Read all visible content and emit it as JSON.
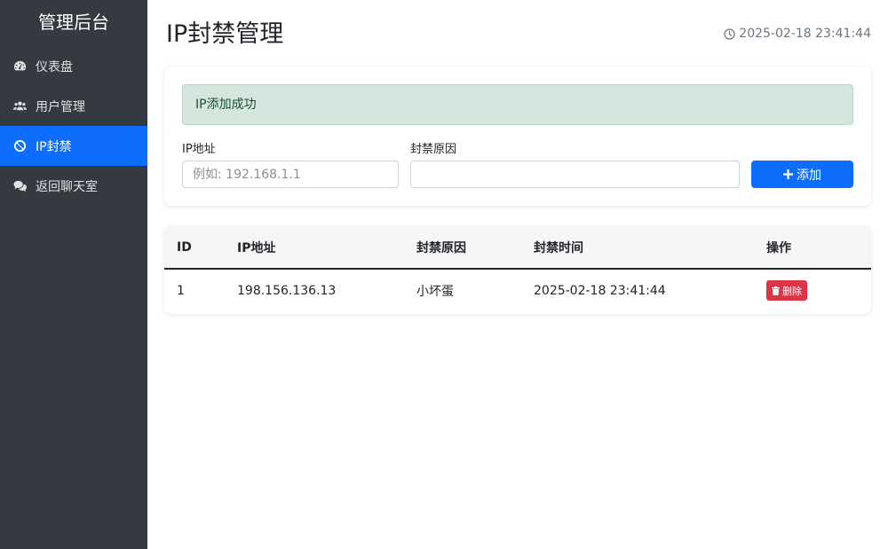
{
  "sidebar": {
    "title": "管理后台",
    "items": [
      {
        "label": "仪表盘",
        "icon": "dashboard-icon"
      },
      {
        "label": "用户管理",
        "icon": "users-icon"
      },
      {
        "label": "IP封禁",
        "icon": "ban-icon",
        "active": true
      },
      {
        "label": "返回聊天室",
        "icon": "chat-icon"
      }
    ]
  },
  "header": {
    "title": "IP封禁管理",
    "time": "2025-02-18 23:41:44"
  },
  "form": {
    "alert": "IP添加成功",
    "ip_label": "IP地址",
    "ip_placeholder": "例如: 192.168.1.1",
    "ip_value": "",
    "reason_label": "封禁原因",
    "reason_value": "",
    "add_button": "添加"
  },
  "table": {
    "headers": [
      "ID",
      "IP地址",
      "封禁原因",
      "封禁时间",
      "操作"
    ],
    "rows": [
      {
        "id": "1",
        "ip": "198.156.136.13",
        "reason": "小坏蛋",
        "time": "2025-02-18 23:41:44",
        "action": "删除"
      }
    ]
  },
  "colors": {
    "sidebar_bg": "#343a40",
    "accent": "#0d6efd",
    "success_bg": "#d4e6dd",
    "danger": "#dc3545"
  }
}
